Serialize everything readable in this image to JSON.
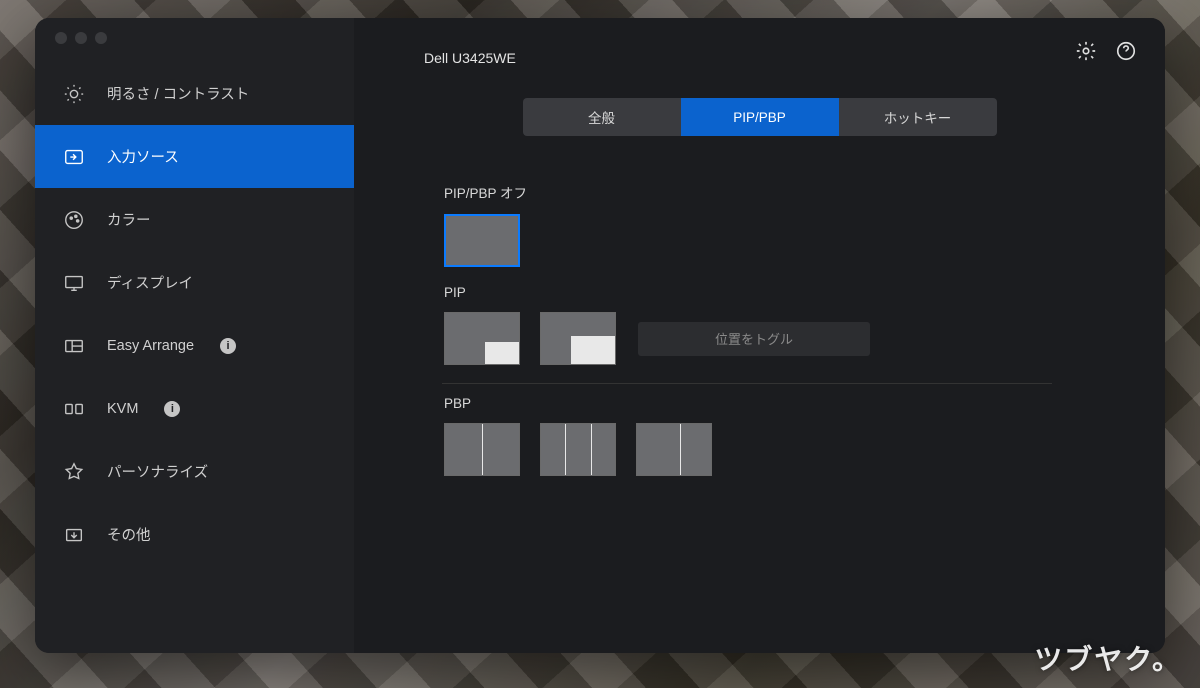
{
  "window": {
    "title": "Dell U3425WE"
  },
  "sidebar": {
    "items": [
      {
        "label": "明るさ / コントラスト"
      },
      {
        "label": "入力ソース"
      },
      {
        "label": "カラー"
      },
      {
        "label": "ディスプレイ"
      },
      {
        "label": "Easy Arrange"
      },
      {
        "label": "KVM"
      },
      {
        "label": "パーソナライズ"
      },
      {
        "label": "その他"
      }
    ]
  },
  "tabs": {
    "general": "全般",
    "pippbp": "PIP/PBP",
    "hotkey": "ホットキー"
  },
  "sections": {
    "off_label": "PIP/PBP  オフ",
    "pip_label": "PIP",
    "pbp_label": "PBP",
    "toggle_position": "位置をトグル"
  },
  "watermark": "ツブヤク。"
}
